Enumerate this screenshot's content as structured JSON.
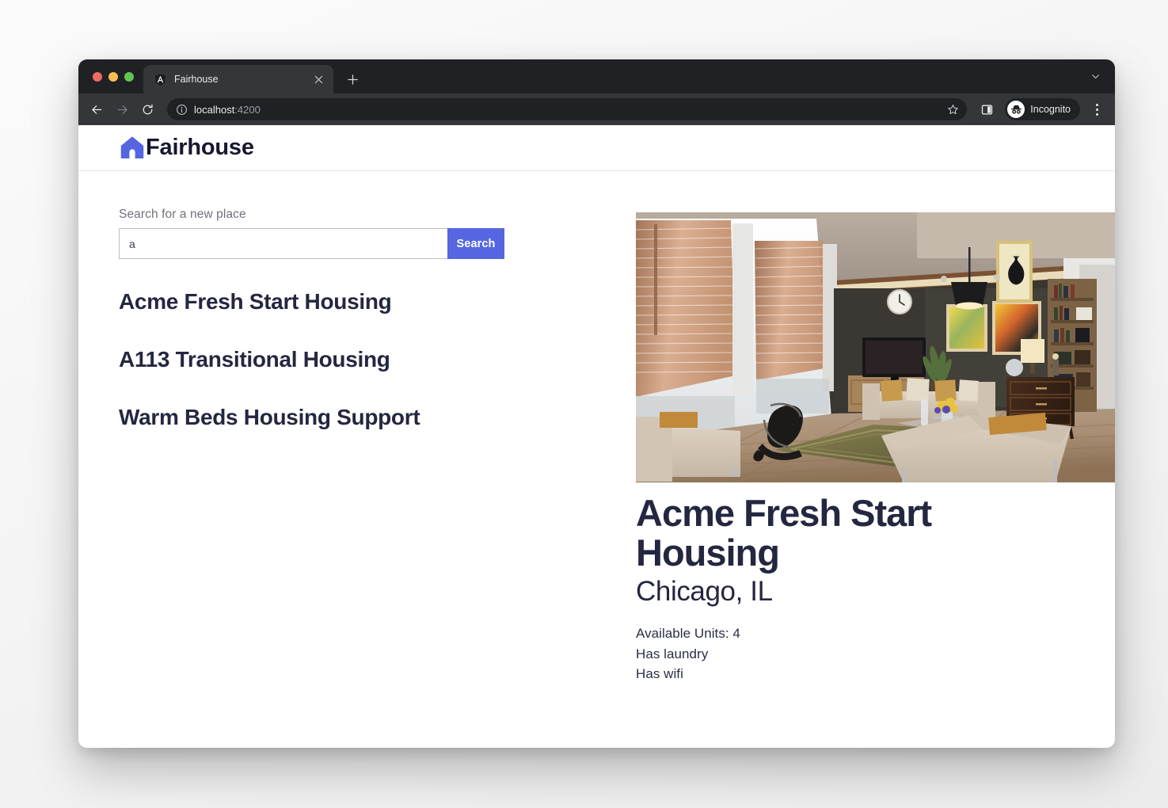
{
  "browser": {
    "tab": {
      "title": "Fairhouse",
      "favicon_icon": "angular-shield-icon",
      "close_icon": "close-icon"
    },
    "new_tab_icon": "plus-icon",
    "tabstrip_chevron_icon": "chevron-down-icon",
    "toolbar": {
      "back_icon": "arrow-left-icon",
      "forward_icon": "arrow-right-icon",
      "reload_icon": "reload-icon",
      "site_info_icon": "info-circle-icon",
      "url_host": "localhost",
      "url_port": ":4200",
      "bookmark_icon": "star-icon",
      "sidepanel_icon": "side-panel-icon",
      "incognito_icon": "incognito-icon",
      "incognito_label": "Incognito",
      "menu_icon": "kebab-menu-icon"
    }
  },
  "app": {
    "brand": {
      "logo_icon": "house-logo-icon",
      "name": "Fairhouse"
    },
    "search": {
      "label": "Search for a new place",
      "value": "a",
      "placeholder": "",
      "button_label": "Search"
    },
    "results": [
      {
        "name": "Acme Fresh Start Housing"
      },
      {
        "name": "A113 Transitional Housing"
      },
      {
        "name": "Warm Beds Housing Support"
      }
    ],
    "detail": {
      "photo_alt": "living-room-photo",
      "title": "Acme Fresh Start Housing",
      "location": "Chicago, IL",
      "facts": [
        "Available Units: 4",
        "Has laundry",
        "Has wifi"
      ]
    }
  },
  "colors": {
    "accent": "#5566e0",
    "heading": "#232740",
    "muted_text": "#6f7280",
    "chrome_dark": "#202124",
    "chrome_toolbar": "#35363a"
  }
}
